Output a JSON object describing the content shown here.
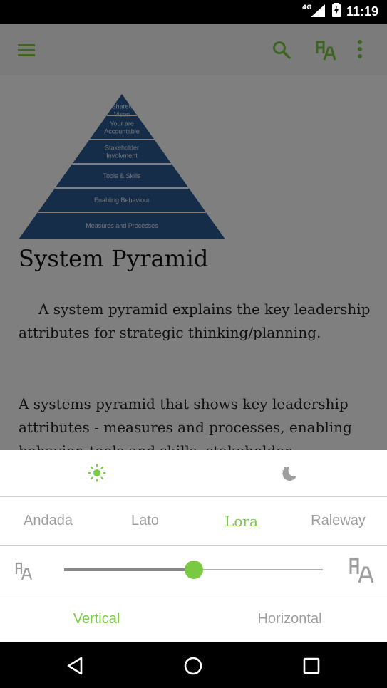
{
  "status_bar": {
    "time": "11:19",
    "network": "4G"
  },
  "app_bar": {
    "icons": [
      "menu-icon",
      "search-icon",
      "font-settings-icon",
      "more-icon"
    ]
  },
  "article": {
    "pyramid_levels": [
      "Shared Vison",
      "Your are Accountable",
      "Stakeholder Involvment",
      "Tools & Skills",
      "Enabling Behaviour",
      "Measures and Processes"
    ],
    "title": "System Pyramid",
    "paragraph1": "A system pyramid explains the key leadership attributes for strategic thinking/planning.",
    "paragraph2": "A systems pyramid that shows key leadership attributes - measures and processes, enabling behavior, tools and skills, stakeholder"
  },
  "settings_sheet": {
    "theme": {
      "options": [
        "day-icon",
        "night-icon"
      ],
      "selected": "day"
    },
    "fonts": [
      {
        "label": "Andada",
        "selected": false
      },
      {
        "label": "Lato",
        "selected": false
      },
      {
        "label": "Lora",
        "selected": true
      },
      {
        "label": "Raleway",
        "selected": false
      }
    ],
    "font_size": {
      "level": 0.5
    },
    "orientation": [
      {
        "label": "Vertical",
        "selected": true
      },
      {
        "label": "Horizontal",
        "selected": false
      }
    ]
  },
  "colors": {
    "accent": "#7ac943",
    "pyramid_blue": "#2a5a92",
    "status_bar": "#000000"
  }
}
